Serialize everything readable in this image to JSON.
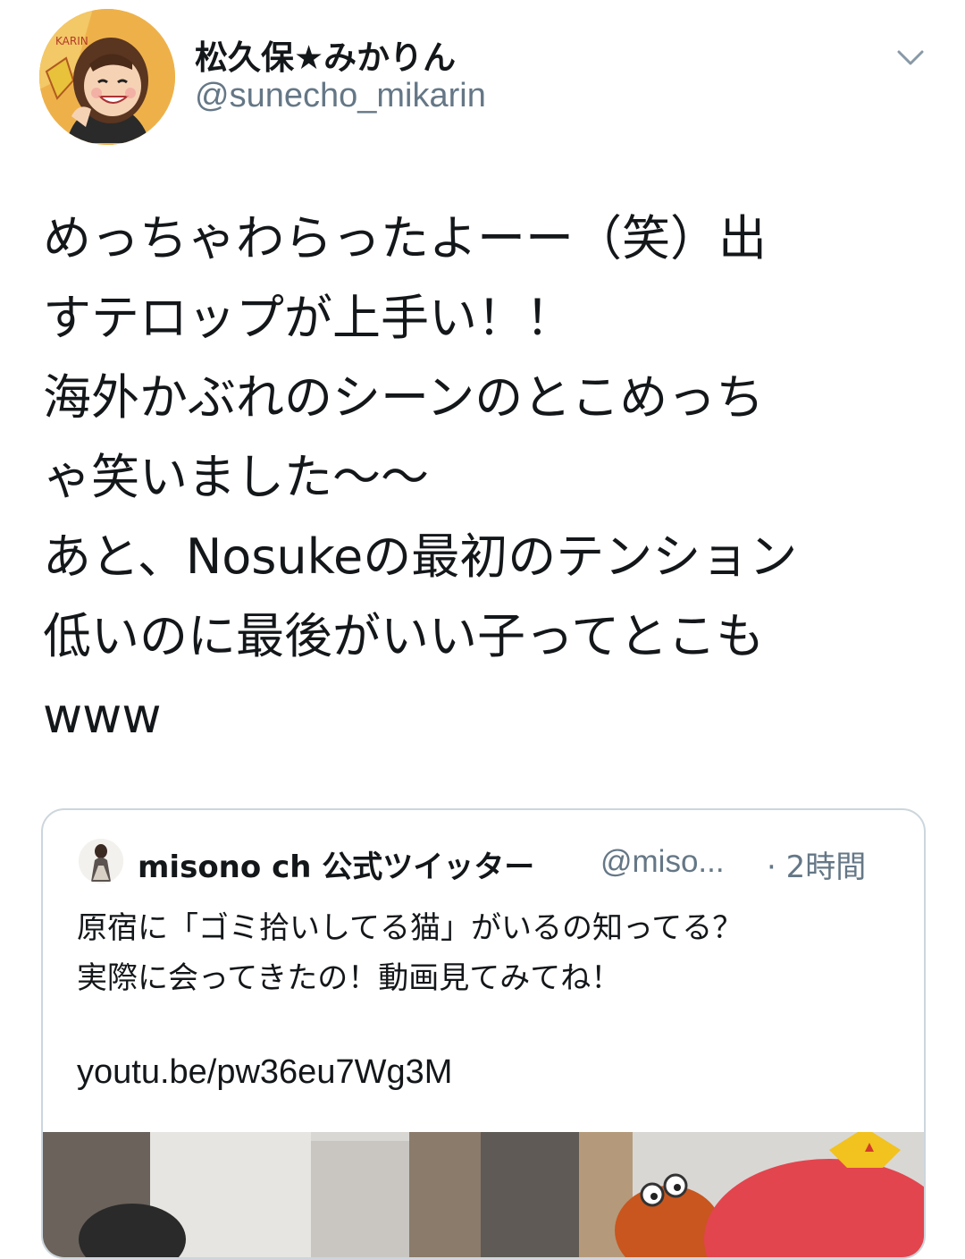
{
  "user": {
    "display_name": "松久保★みかりん",
    "handle": "@sunecho_mikarin",
    "avatar_text": "KARIN"
  },
  "tweet": {
    "text": "めっちゃわらったよーー（笑）出\nすテロップが上手い！！\n海外かぶれのシーンのとこめっち\nゃ笑いました〜〜\nあと、Nosukeの最初のテンション\n低いのに最後がいい子ってとこも\nwww"
  },
  "quoted_tweet": {
    "display_name": "misono ch 公式ツイッター",
    "handle": "@miso...",
    "time": "· 2時間",
    "text": "原宿に「ゴミ拾いしてる猫」がいるの知ってる？\n実際に会ってきたの！動画見てみてね！",
    "link": "youtu.be/pw36eu7Wg3M"
  },
  "icons": {
    "menu": "chevron-down-icon"
  },
  "colors": {
    "text_primary": "#14171a",
    "text_secondary": "#657786",
    "border": "#ccd6dd"
  }
}
